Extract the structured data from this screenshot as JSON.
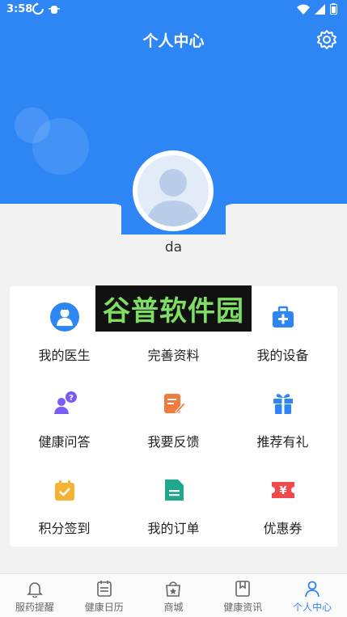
{
  "status_bar": {
    "time": "3:58"
  },
  "header": {
    "title": "个人中心"
  },
  "profile": {
    "username": "da"
  },
  "watermark": {
    "text": "谷普软件园"
  },
  "menu": {
    "items": [
      {
        "label": "我的医生",
        "icon": "doctor-icon",
        "color": "#2e86f5"
      },
      {
        "label": "完善资料",
        "icon": "profile-edit-icon",
        "color": "#2e86f5"
      },
      {
        "label": "我的设备",
        "icon": "medical-kit-icon",
        "color": "#2e86f5"
      },
      {
        "label": "健康问答",
        "icon": "qa-icon",
        "color": "#7a5af8"
      },
      {
        "label": "我要反馈",
        "icon": "feedback-icon",
        "color": "#f07b3f"
      },
      {
        "label": "推荐有礼",
        "icon": "gift-icon",
        "color": "#2e86f5"
      },
      {
        "label": "积分签到",
        "icon": "checkin-icon",
        "color": "#f5b335"
      },
      {
        "label": "我的订单",
        "icon": "order-icon",
        "color": "#1fa88c"
      },
      {
        "label": "优惠券",
        "icon": "coupon-icon",
        "color": "#ee4a4a"
      }
    ]
  },
  "tabbar": {
    "items": [
      {
        "label": "服药提醒",
        "icon": "bell-icon",
        "active": false
      },
      {
        "label": "健康日历",
        "icon": "calendar-icon",
        "active": false
      },
      {
        "label": "商城",
        "icon": "shop-icon",
        "active": false
      },
      {
        "label": "健康资讯",
        "icon": "bookmark-icon",
        "active": false
      },
      {
        "label": "个人中心",
        "icon": "person-icon",
        "active": true
      }
    ]
  },
  "colors": {
    "primary": "#2e86f5",
    "background": "#f2f2f2"
  }
}
